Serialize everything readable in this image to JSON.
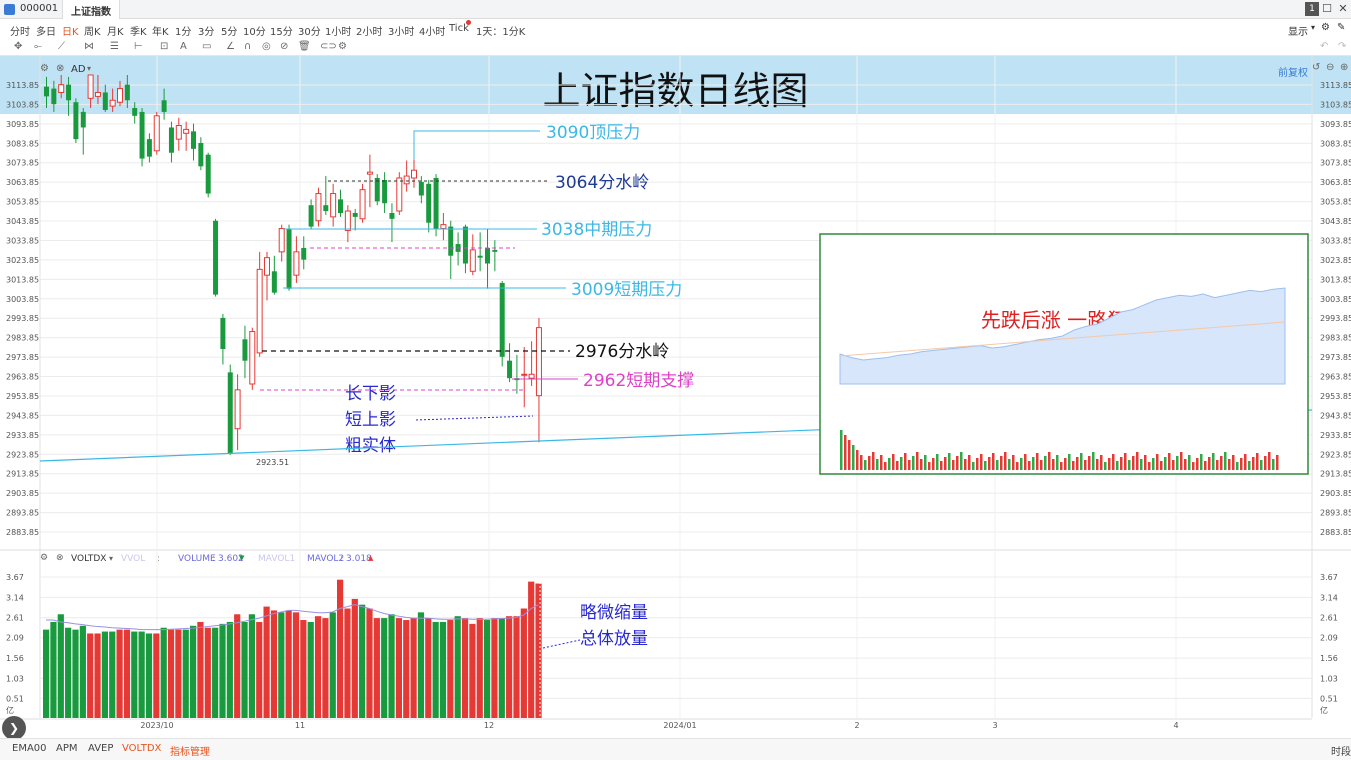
{
  "window": {
    "code": "000001",
    "tab": "上证指数",
    "display_label": "显示",
    "rights_label": "前复权"
  },
  "periods": [
    "分时",
    "多日",
    "日K",
    "周K",
    "月K",
    "季K",
    "年K",
    "1分",
    "3分",
    "5分",
    "10分",
    "15分",
    "30分",
    "1小时",
    "2小时",
    "3小时",
    "4小时",
    "Tick",
    "1天：1分K"
  ],
  "active_period": "日K",
  "main_panel": {
    "indicator": "AD",
    "title": "上证指数日线图"
  },
  "volume_panel": {
    "indicator": "VOLTDX",
    "vvol_label": "VVOL",
    "volume_label": "VOLUME",
    "volume_value": "3.602",
    "mavol1_label": "MAVOL1",
    "mavol2_label": "MAVOL2",
    "mavol2_value": "3.018",
    "unit": "亿"
  },
  "bottom_tabs": [
    "EMA00",
    "APM",
    "AVEP",
    "VOLTDX",
    "指标管理"
  ],
  "active_bottom_tab": "VOLTDX",
  "bottom_right_label": "时段",
  "colors": {
    "up": "#e53935",
    "down": "#1a9a3e",
    "cyan": "#3bb8e6",
    "magenta": "#e040c8",
    "navy": "#1f3a93",
    "blue_text": "#2828d0"
  },
  "chart_data": [
    {
      "type": "candlestick",
      "title": "上证指数日线图",
      "y_ticks": [
        "3113.85",
        "3103.85",
        "3093.85",
        "3083.85",
        "3073.85",
        "3063.85",
        "3053.85",
        "3043.85",
        "3033.85",
        "3023.85",
        "3013.85",
        "3003.85",
        "2993.85",
        "2983.85",
        "2973.85",
        "2963.85",
        "2953.85",
        "2943.85",
        "2933.85",
        "2923.85",
        "2913.85",
        "2903.85",
        "2893.85",
        "2883.85"
      ],
      "ylim": [
        2878,
        3119
      ],
      "x_labels": [
        "2023/10",
        "11",
        "12",
        "2024/01",
        "2",
        "3",
        "4"
      ],
      "low_label": "2923.51",
      "candles": [
        {
          "o": 3113,
          "c": 3108,
          "h": 3118,
          "l": 3102
        },
        {
          "o": 3112,
          "c": 3104,
          "h": 3116,
          "l": 3100
        },
        {
          "o": 3110,
          "c": 3114,
          "h": 3119,
          "l": 3107
        },
        {
          "o": 3114,
          "c": 3106,
          "h": 3118,
          "l": 3098
        },
        {
          "o": 3105,
          "c": 3086,
          "h": 3107,
          "l": 3084
        },
        {
          "o": 3100,
          "c": 3092,
          "h": 3102,
          "l": 3078
        },
        {
          "o": 3107,
          "c": 3119,
          "h": 3119,
          "l": 3102
        },
        {
          "o": 3108,
          "c": 3110,
          "h": 3119,
          "l": 3104
        },
        {
          "o": 3110,
          "c": 3101,
          "h": 3114,
          "l": 3100
        },
        {
          "o": 3103,
          "c": 3106,
          "h": 3112,
          "l": 3100
        },
        {
          "o": 3105,
          "c": 3112,
          "h": 3116,
          "l": 3103
        },
        {
          "o": 3114,
          "c": 3106,
          "h": 3119,
          "l": 3102
        },
        {
          "o": 3102,
          "c": 3098,
          "h": 3105,
          "l": 3094
        },
        {
          "o": 3100,
          "c": 3076,
          "h": 3102,
          "l": 3072
        },
        {
          "o": 3086,
          "c": 3077,
          "h": 3089,
          "l": 3074
        },
        {
          "o": 3080,
          "c": 3098,
          "h": 3100,
          "l": 3078
        },
        {
          "o": 3106,
          "c": 3100,
          "h": 3112,
          "l": 3096
        },
        {
          "o": 3092,
          "c": 3079,
          "h": 3095,
          "l": 3074
        },
        {
          "o": 3086,
          "c": 3093,
          "h": 3097,
          "l": 3080
        },
        {
          "o": 3089,
          "c": 3091,
          "h": 3095,
          "l": 3080
        },
        {
          "o": 3090,
          "c": 3081,
          "h": 3094,
          "l": 3075
        },
        {
          "o": 3084,
          "c": 3072,
          "h": 3087,
          "l": 3070
        },
        {
          "o": 3078,
          "c": 3058,
          "h": 3079,
          "l": 3056
        },
        {
          "o": 3044,
          "c": 3006,
          "h": 3045,
          "l": 3005
        },
        {
          "o": 2994,
          "c": 2978,
          "h": 2996,
          "l": 2970
        },
        {
          "o": 2966,
          "c": 2924,
          "h": 2970,
          "l": 2923.5
        },
        {
          "o": 2937,
          "c": 2957,
          "h": 2965,
          "l": 2926
        },
        {
          "o": 2983,
          "c": 2972,
          "h": 2990,
          "l": 2963
        },
        {
          "o": 2960,
          "c": 2987,
          "h": 2989,
          "l": 2957
        },
        {
          "o": 2976,
          "c": 3019,
          "h": 3028,
          "l": 2974
        },
        {
          "o": 3016,
          "c": 3025,
          "h": 3028,
          "l": 3003
        },
        {
          "o": 3018,
          "c": 3007,
          "h": 3026,
          "l": 3006
        },
        {
          "o": 3028,
          "c": 3040,
          "h": 3042,
          "l": 3023
        },
        {
          "o": 3040,
          "c": 3009,
          "h": 3042,
          "l": 3008
        },
        {
          "o": 3016,
          "c": 3028,
          "h": 3036,
          "l": 3012
        },
        {
          "o": 3030,
          "c": 3024,
          "h": 3036,
          "l": 3019
        },
        {
          "o": 3052,
          "c": 3041,
          "h": 3055,
          "l": 3040
        },
        {
          "o": 3044,
          "c": 3058,
          "h": 3061,
          "l": 3041
        },
        {
          "o": 3052,
          "c": 3049,
          "h": 3067,
          "l": 3047
        },
        {
          "o": 3046,
          "c": 3058,
          "h": 3063,
          "l": 3041
        },
        {
          "o": 3055,
          "c": 3048,
          "h": 3060,
          "l": 3046
        },
        {
          "o": 3039,
          "c": 3049,
          "h": 3052,
          "l": 3033
        },
        {
          "o": 3048,
          "c": 3046,
          "h": 3050,
          "l": 3039
        },
        {
          "o": 3045,
          "c": 3060,
          "h": 3063,
          "l": 3043
        },
        {
          "o": 3068,
          "c": 3069,
          "h": 3078,
          "l": 3051
        },
        {
          "o": 3066,
          "c": 3054,
          "h": 3068,
          "l": 3052
        },
        {
          "o": 3065,
          "c": 3053,
          "h": 3069,
          "l": 3048
        },
        {
          "o": 3048,
          "c": 3045,
          "h": 3053,
          "l": 3033
        },
        {
          "o": 3049,
          "c": 3066,
          "h": 3069,
          "l": 3047
        },
        {
          "o": 3063,
          "c": 3067,
          "h": 3075,
          "l": 3059
        },
        {
          "o": 3066,
          "c": 3070,
          "h": 3089,
          "l": 3061
        },
        {
          "o": 3064,
          "c": 3057,
          "h": 3067,
          "l": 3053
        },
        {
          "o": 3063,
          "c": 3043,
          "h": 3065,
          "l": 3038
        },
        {
          "o": 3066,
          "c": 3040,
          "h": 3068,
          "l": 3036
        },
        {
          "o": 3040,
          "c": 3042,
          "h": 3048,
          "l": 3034
        },
        {
          "o": 3041,
          "c": 3026,
          "h": 3044,
          "l": 3014
        },
        {
          "o": 3032,
          "c": 3028,
          "h": 3038,
          "l": 3021
        },
        {
          "o": 3041,
          "c": 3022,
          "h": 3042,
          "l": 3017
        },
        {
          "o": 3018,
          "c": 3029,
          "h": 3037,
          "l": 3016
        },
        {
          "o": 3026,
          "c": 3025,
          "h": 3038,
          "l": 3018
        },
        {
          "o": 3030,
          "c": 3022,
          "h": 3040,
          "l": 3009
        },
        {
          "o": 3029,
          "c": 3028,
          "h": 3034,
          "l": 3018
        },
        {
          "o": 3012,
          "c": 2974,
          "h": 3013,
          "l": 2969
        },
        {
          "o": 2972,
          "c": 2963,
          "h": 2981,
          "l": 2961
        },
        {
          "o": 2963,
          "c": 2962,
          "h": 2975,
          "l": 2955
        },
        {
          "o": 2965,
          "c": 2965,
          "h": 2979,
          "l": 2948
        },
        {
          "o": 2963,
          "c": 2965,
          "h": 2982,
          "l": 2959
        },
        {
          "o": 2954,
          "c": 2989,
          "h": 2994,
          "l": 2930
        }
      ],
      "annotations": [
        {
          "price": 3090,
          "text": "3090顶压力"
        },
        {
          "price": 3066,
          "text": "3064分水岭"
        },
        {
          "price": 3041,
          "text": "3038中期压力"
        },
        {
          "price": 3010,
          "text": "3009短期压力"
        },
        {
          "price": 2977,
          "text": "2976分水岭"
        },
        {
          "price": 2962,
          "text": "2962短期支撑"
        }
      ],
      "note_lines": [
        "长下影",
        "短上影",
        "粗实体"
      ],
      "inset": {
        "type": "area",
        "title": "先跌后涨 一路狂飙",
        "values": [
          0.25,
          0.22,
          0.2,
          0.21,
          0.22,
          0.24,
          0.25,
          0.27,
          0.28,
          0.29,
          0.3,
          0.31,
          0.32,
          0.3,
          0.31,
          0.33,
          0.35,
          0.37,
          0.38,
          0.4,
          0.45,
          0.48,
          0.5,
          0.55,
          0.6,
          0.62,
          0.66,
          0.7,
          0.72,
          0.74,
          0.73,
          0.75,
          0.72,
          0.74,
          0.76,
          0.78,
          0.77,
          0.79,
          0.8
        ]
      }
    },
    {
      "type": "bar",
      "title": "VOLTDX",
      "y_ticks": [
        "3.67",
        "3.14",
        "2.61",
        "2.09",
        "1.56",
        "1.03",
        "0.51"
      ],
      "ylim": [
        0,
        3.67
      ],
      "values": [
        2.3,
        2.5,
        2.7,
        2.35,
        2.3,
        2.4,
        2.2,
        2.2,
        2.25,
        2.25,
        2.3,
        2.3,
        2.25,
        2.25,
        2.2,
        2.2,
        2.35,
        2.3,
        2.3,
        2.3,
        2.4,
        2.5,
        2.35,
        2.35,
        2.45,
        2.5,
        2.7,
        2.5,
        2.7,
        2.5,
        2.9,
        2.8,
        2.75,
        2.8,
        2.75,
        2.55,
        2.5,
        2.65,
        2.6,
        2.75,
        3.6,
        2.85,
        3.1,
        2.95,
        2.85,
        2.6,
        2.6,
        2.7,
        2.6,
        2.55,
        2.6,
        2.75,
        2.6,
        2.5,
        2.5,
        2.55,
        2.65,
        2.6,
        2.45,
        2.6,
        2.55,
        2.6,
        2.6,
        2.65,
        2.65,
        2.85,
        3.55,
        3.5
      ],
      "colors": [
        "d",
        "d",
        "d",
        "d",
        "d",
        "d",
        "u",
        "u",
        "d",
        "d",
        "u",
        "u",
        "d",
        "d",
        "d",
        "u",
        "d",
        "u",
        "u",
        "d",
        "d",
        "u",
        "u",
        "d",
        "d",
        "d",
        "u",
        "d",
        "d",
        "u",
        "u",
        "u",
        "d",
        "u",
        "u",
        "u",
        "d",
        "u",
        "u",
        "d",
        "u",
        "u",
        "u",
        "d",
        "u",
        "u",
        "d",
        "d",
        "u",
        "u",
        "u",
        "d",
        "u",
        "d",
        "d",
        "u",
        "d",
        "u",
        "u",
        "u",
        "d",
        "u",
        "d",
        "u",
        "u",
        "u",
        "u",
        "u"
      ],
      "ma": [
        2.55,
        2.55,
        2.5,
        2.48,
        2.45,
        2.43,
        2.4,
        2.38,
        2.37,
        2.35,
        2.34,
        2.33,
        2.32,
        2.3,
        2.3,
        2.3,
        2.3,
        2.31,
        2.32,
        2.33,
        2.34,
        2.36,
        2.38,
        2.4,
        2.42,
        2.45,
        2.48,
        2.52,
        2.56,
        2.6,
        2.66,
        2.72,
        2.76,
        2.8,
        2.8,
        2.78,
        2.76,
        2.74,
        2.74,
        2.76,
        2.85,
        2.9,
        2.95,
        2.9,
        2.85,
        2.78,
        2.72,
        2.68,
        2.65,
        2.62,
        2.6,
        2.6,
        2.6,
        2.58,
        2.57,
        2.57,
        2.58,
        2.58,
        2.57,
        2.57,
        2.57,
        2.58,
        2.59,
        2.6,
        2.62,
        2.68,
        2.85,
        2.95
      ],
      "notes": [
        "略微缩量",
        "总体放量"
      ]
    }
  ]
}
